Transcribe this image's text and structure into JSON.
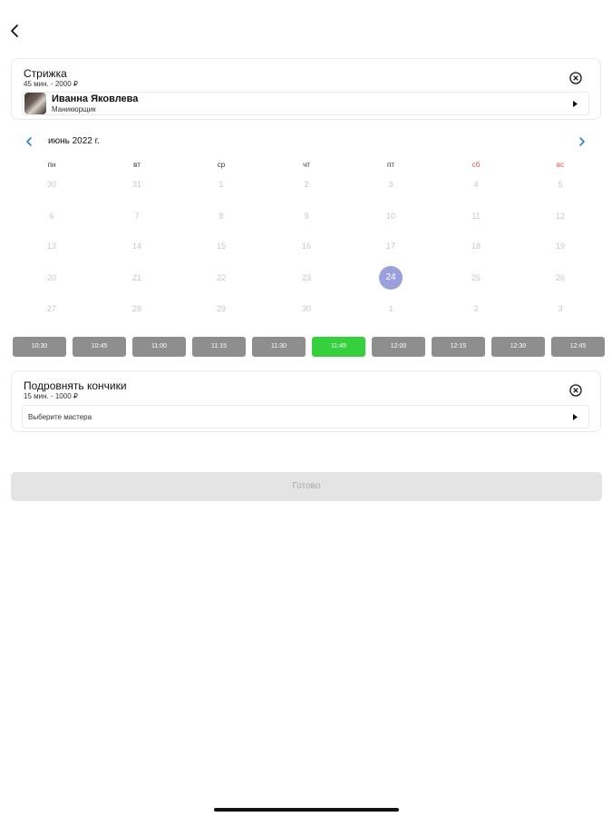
{
  "services": [
    {
      "title": "Стрижка",
      "meta": "45 мин. - 2000 ₽",
      "master": {
        "name": "Иванна Яковлева",
        "role": "Маникюрщик"
      }
    },
    {
      "title": "Подровнять кончики",
      "meta": "15 мин. - 1000 ₽",
      "master_placeholder": "Выберите мастера"
    }
  ],
  "calendar": {
    "month_label": "июнь 2022 г.",
    "weekdays": [
      "пн",
      "вт",
      "ср",
      "чт",
      "пт",
      "сб",
      "вс"
    ],
    "weeks": [
      [
        "30",
        "31",
        "1",
        "2",
        "3",
        "4",
        "5"
      ],
      [
        "6",
        "7",
        "8",
        "9",
        "10",
        "11",
        "12"
      ],
      [
        "13",
        "14",
        "15",
        "16",
        "17",
        "18",
        "19"
      ],
      [
        "20",
        "21",
        "22",
        "23",
        "24",
        "25",
        "26"
      ],
      [
        "27",
        "28",
        "29",
        "30",
        "1",
        "2",
        "3"
      ]
    ],
    "selected_day": "24"
  },
  "time_slots": [
    "10:30",
    "10:45",
    "11:00",
    "11:15",
    "11:30",
    "11:45",
    "12:00",
    "12:15",
    "12:30",
    "12:45"
  ],
  "selected_slot": "11:45",
  "done_label": "Готово",
  "colors": {
    "selected_day": "#9aa0dc",
    "selected_slot": "#34d13d",
    "slot": "#8e8e8e",
    "weekend": "#d9534f",
    "nav_arrow": "#2f7fd6"
  }
}
